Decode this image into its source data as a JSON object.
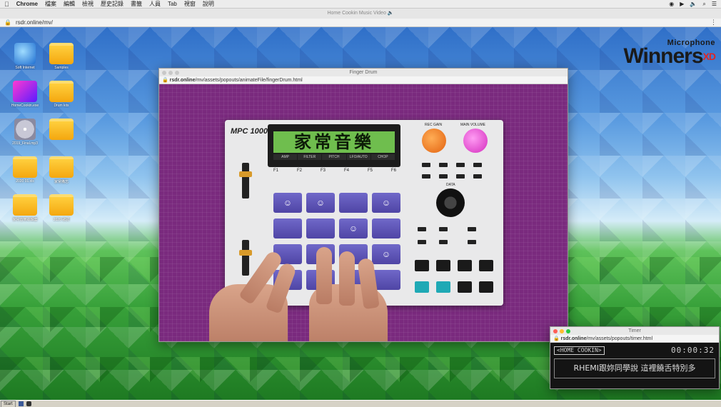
{
  "menubar": {
    "app": "Chrome",
    "items": [
      "檔案",
      "編輯",
      "檢視",
      "歷史記錄",
      "書籤",
      "人員",
      "Tab",
      "視窗",
      "說明"
    ]
  },
  "browser": {
    "window_title": "Home Cookin Music Video 🔈",
    "url": "rsdr.online/mv/"
  },
  "desktop": {
    "icons": [
      {
        "label": "Soft Internet",
        "kind": "ie"
      },
      {
        "label": "Samples",
        "kind": "folder"
      },
      {
        "label": "HomeCookin.exe",
        "kind": "app"
      },
      {
        "label": "Drum kits",
        "kind": "folder"
      },
      {
        "label": "2019_Final.mp3",
        "kind": "cd"
      },
      {
        "label": "",
        "kind": "folder"
      },
      {
        "label": "2020 01.xls",
        "kind": "folder"
      },
      {
        "label": "家常備忘",
        "kind": "folder"
      },
      {
        "label": "家常音樂專輯套",
        "kind": "folder"
      },
      {
        "label": "2020 歌詞",
        "kind": "folder"
      }
    ],
    "logo": {
      "top": "Microphone",
      "main": "Winners",
      "accent": "XD"
    }
  },
  "drum_window": {
    "title": "Finger Drum",
    "url_domain": "rsdr.online",
    "url_path": "/mv/assets/popouts/animateFile/fingerDrum.html",
    "device": {
      "brand": "MPC 1000",
      "screen_text": "家常音樂",
      "screen_tabs": [
        "AMP",
        "FILTER",
        "PITCH",
        "LFO/AUTO",
        "CHOP"
      ],
      "fkeys": [
        "F1",
        "F2",
        "F3",
        "F4",
        "F5",
        "F6"
      ],
      "knob_labels": [
        "REC GAIN",
        "MAIN VOLUME"
      ],
      "data_label": "DATA",
      "pad_faces": [
        "☺",
        "☺",
        "",
        "☺",
        "",
        "",
        "☺",
        "",
        "",
        "☺",
        "",
        "☺",
        "☺",
        "",
        "",
        ""
      ]
    }
  },
  "timer_window": {
    "title": "Timer",
    "url_domain": "rsdr.online",
    "url_path": "/mv/assets/popouts/timer.html",
    "tag": "<HOME COOKIN>",
    "time": "00:00:32",
    "subtitle": "RHEMI跟妳同學說 這裡饒舌特別多"
  },
  "taskbar": {
    "start": "Start"
  },
  "colors": {
    "drum_bg": "#7a2a7e",
    "pad": "#5a51b4",
    "lcd": "#6fbe4e",
    "rec_gain": "#f07a1c",
    "main_volume": "#e03ccb",
    "teal": "#1fa9b5"
  }
}
